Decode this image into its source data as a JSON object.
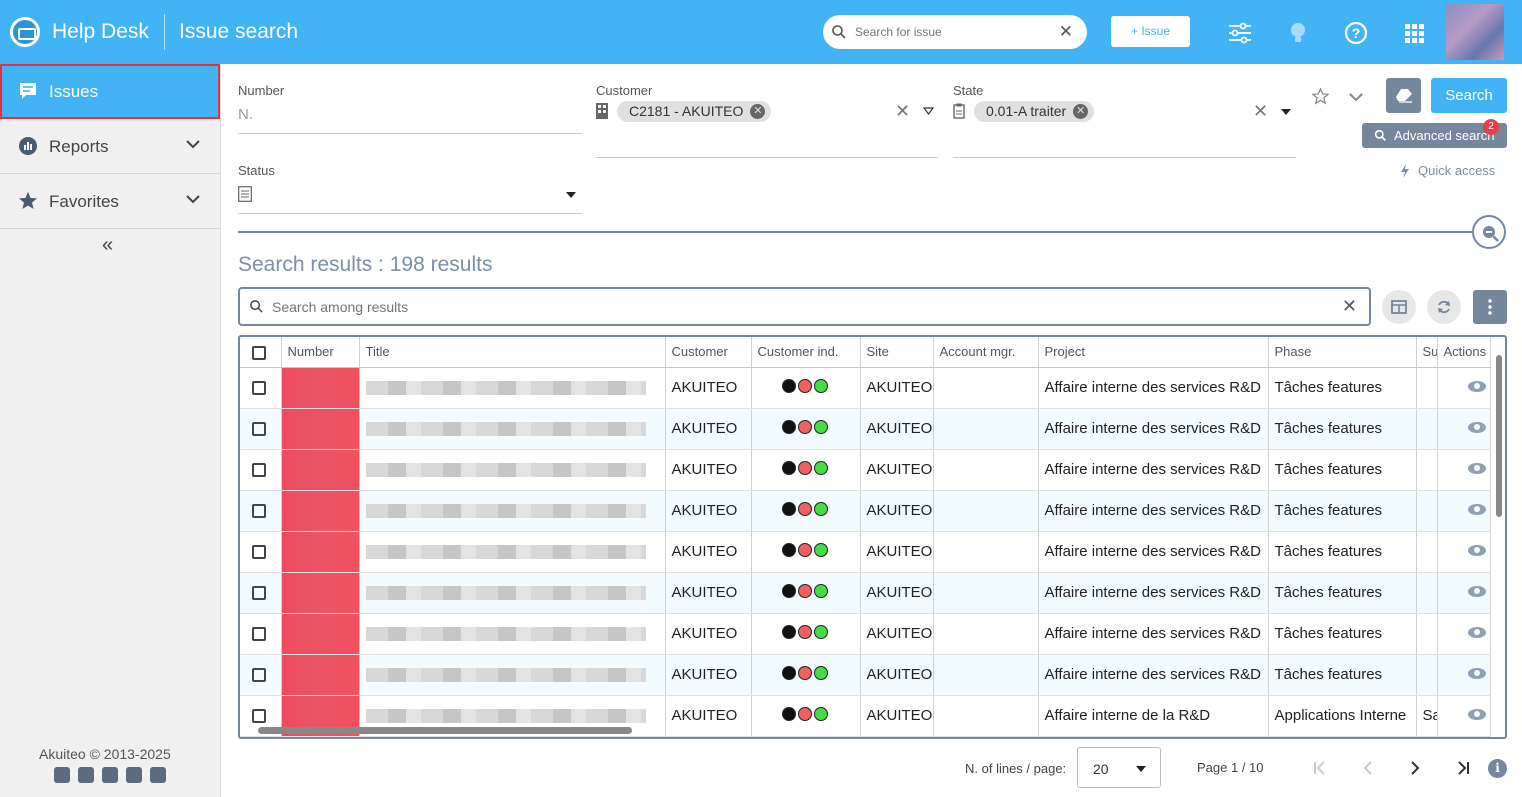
{
  "header": {
    "app_title": "Help Desk",
    "page_title": "Issue search",
    "search_placeholder": "Search for issue",
    "new_issue_label": "+ Issue",
    "icons": [
      "sliders-icon",
      "lightbulb-icon",
      "help-icon",
      "apps-grid-icon"
    ]
  },
  "sidebar": {
    "items": [
      {
        "label": "Issues",
        "icon": "chat-icon",
        "active": true
      },
      {
        "label": "Reports",
        "icon": "chart-icon"
      },
      {
        "label": "Favorites",
        "icon": "star-icon"
      }
    ],
    "collapse_label": "«",
    "copyright": "Akuiteo © 2013-2025"
  },
  "filters": {
    "number": {
      "label": "Number",
      "placeholder": "N."
    },
    "customer": {
      "label": "Customer",
      "chip": "C2181 - AKUITEO"
    },
    "state": {
      "label": "State",
      "chip": "0.01-A traiter"
    },
    "status": {
      "label": "Status"
    },
    "search_label": "Search",
    "advanced_label": "Advanced search",
    "advanced_badge": "2",
    "quick_access_label": "Quick access"
  },
  "results": {
    "title": "Search results : 198 results",
    "search_placeholder": "Search among results",
    "columns": [
      "Number",
      "Title",
      "Customer",
      "Customer ind.",
      "Site",
      "Account mgr.",
      "Project",
      "Phase",
      "Su",
      "Actions"
    ],
    "rows": [
      {
        "customer": "AKUITEO",
        "site": "AKUITEO",
        "account_mgr": "",
        "project": "Affaire interne des services R&D",
        "phase": "Tâches features",
        "su": ""
      },
      {
        "customer": "AKUITEO",
        "site": "AKUITEO",
        "account_mgr": "",
        "project": "Affaire interne des services R&D",
        "phase": "Tâches features",
        "su": ""
      },
      {
        "customer": "AKUITEO",
        "site": "AKUITEO",
        "account_mgr": "",
        "project": "Affaire interne des services R&D",
        "phase": "Tâches features",
        "su": ""
      },
      {
        "customer": "AKUITEO",
        "site": "AKUITEO",
        "account_mgr": "",
        "project": "Affaire interne des services R&D",
        "phase": "Tâches features",
        "su": ""
      },
      {
        "customer": "AKUITEO",
        "site": "AKUITEO",
        "account_mgr": "",
        "project": "Affaire interne des services R&D",
        "phase": "Tâches features",
        "su": ""
      },
      {
        "customer": "AKUITEO",
        "site": "AKUITEO",
        "account_mgr": "",
        "project": "Affaire interne des services R&D",
        "phase": "Tâches features",
        "su": ""
      },
      {
        "customer": "AKUITEO",
        "site": "AKUITEO",
        "account_mgr": "",
        "project": "Affaire interne des services R&D",
        "phase": "Tâches features",
        "su": ""
      },
      {
        "customer": "AKUITEO",
        "site": "AKUITEO",
        "account_mgr": "",
        "project": "Affaire interne des services R&D",
        "phase": "Tâches features",
        "su": ""
      },
      {
        "customer": "AKUITEO",
        "site": "AKUITEO",
        "account_mgr": "",
        "project": "Affaire interne de la R&D",
        "phase": "Applications Interne",
        "su": "Sa"
      }
    ],
    "indicator_colors": [
      "#111111",
      "#f06060",
      "#44dd44"
    ]
  },
  "pager": {
    "lines_label": "N. of lines / page:",
    "lines_value": "20",
    "page_info": "Page 1 / 10"
  },
  "colors": {
    "accent": "#42b4f5",
    "slate": "#75879c",
    "highlight": "#e0333e"
  }
}
